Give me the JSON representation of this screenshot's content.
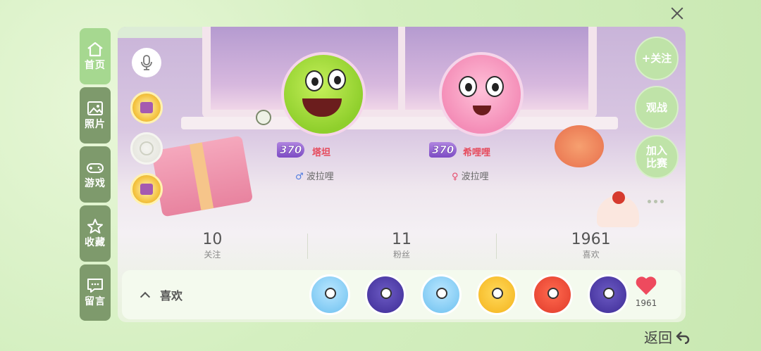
{
  "nav": {
    "items": [
      {
        "label": "首页",
        "icon": "home-icon"
      },
      {
        "label": "照片",
        "icon": "photo-icon"
      },
      {
        "label": "游戏",
        "icon": "gamepad-icon"
      },
      {
        "label": "收藏",
        "icon": "star-icon"
      },
      {
        "label": "留言",
        "icon": "message-icon"
      }
    ],
    "active": "首页"
  },
  "players": [
    {
      "level": "370",
      "name": "塔坦",
      "gender_symbol": "♂",
      "team": "波拉哩",
      "avatar_color": "#9bd63a"
    },
    {
      "level": "370",
      "name": "希哩哩",
      "gender_symbol": "♀",
      "team": "波拉哩",
      "avatar_color": "#f7a3c6"
    }
  ],
  "actions": {
    "follow": "+关注",
    "watch": "观战",
    "join": "加入比赛"
  },
  "stats": [
    {
      "value": "10",
      "label": "关注"
    },
    {
      "value": "11",
      "label": "粉丝"
    },
    {
      "value": "1961",
      "label": "喜欢"
    }
  ],
  "likes": {
    "label": "喜欢",
    "count": "1961",
    "fans": [
      "blue",
      "purple",
      "blue",
      "yellow",
      "red",
      "purple"
    ]
  },
  "back_label": "返回",
  "colors": {
    "nav_active": "#a6d890",
    "nav_inactive": "#7e9a6c",
    "accent_name": "#e64a5c",
    "heart": "#ee4a5e"
  }
}
